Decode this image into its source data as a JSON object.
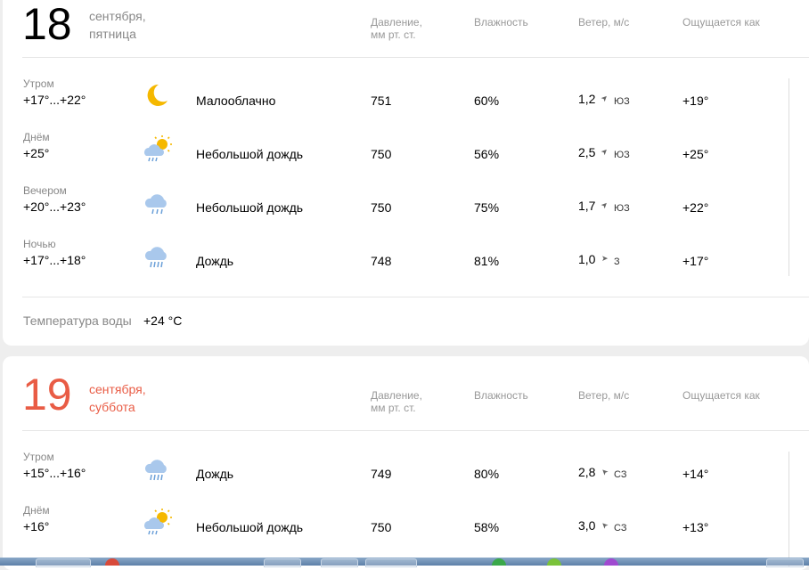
{
  "headers": {
    "pressure_line1": "Давление,",
    "pressure_line2": "мм рт. ст.",
    "humidity": "Влажность",
    "wind": "Ветер, м/с",
    "feels": "Ощущается как"
  },
  "days": [
    {
      "day": "18",
      "date_line1": "сентября,",
      "date_line2": "пятница",
      "accent_color": "#000000",
      "rows": [
        {
          "part": "Утром",
          "temp": "+17°...+22°",
          "icon": "crescent-moon-icon",
          "cond": "Малооблачно",
          "pressure": "751",
          "humidity": "60%",
          "wind": "1,2",
          "dir_arrow": "➤",
          "dir": "ЮЗ",
          "feels": "+19°"
        },
        {
          "part": "Днём",
          "temp": "+25°",
          "icon": "sun-cloud-rain-icon",
          "cond": "Небольшой дождь",
          "pressure": "750",
          "humidity": "56%",
          "wind": "2,5",
          "dir_arrow": "➤",
          "dir": "ЮЗ",
          "feels": "+25°"
        },
        {
          "part": "Вечером",
          "temp": "+20°...+23°",
          "icon": "cloud-rain-icon",
          "cond": "Небольшой дождь",
          "pressure": "750",
          "humidity": "75%",
          "wind": "1,7",
          "dir_arrow": "➤",
          "dir": "ЮЗ",
          "feels": "+22°"
        },
        {
          "part": "Ночью",
          "temp": "+17°...+18°",
          "icon": "cloud-heavy-rain-icon",
          "cond": "Дождь",
          "pressure": "748",
          "humidity": "81%",
          "wind": "1,0",
          "dir_arrow": "➤",
          "dir": "З",
          "feels": "+17°"
        }
      ],
      "water_label": "Температура воды",
      "water_value": "+24 °C"
    },
    {
      "day": "19",
      "date_line1": "сентября,",
      "date_line2": "суббота",
      "accent_color": "#e95c45",
      "rows": [
        {
          "part": "Утром",
          "temp": "+15°...+16°",
          "icon": "cloud-heavy-rain-icon",
          "cond": "Дождь",
          "pressure": "749",
          "humidity": "80%",
          "wind": "2,8",
          "dir_arrow": "➤",
          "dir": "СЗ",
          "feels": "+14°"
        },
        {
          "part": "Днём",
          "temp": "+16°",
          "icon": "sun-cloud-rain-icon",
          "cond": "Небольшой дождь",
          "pressure": "750",
          "humidity": "58%",
          "wind": "3,0",
          "dir_arrow": "➤",
          "dir": "СЗ",
          "feels": "+13°"
        }
      ]
    }
  ]
}
